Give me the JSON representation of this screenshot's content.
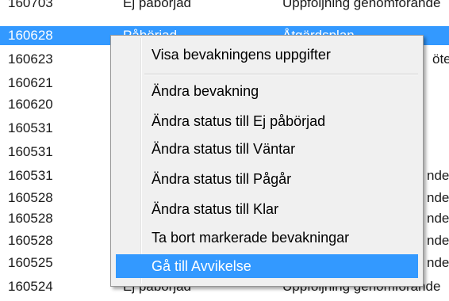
{
  "list": {
    "rows": [
      {
        "date": "160703",
        "status": "Ej påbörjad",
        "desc": "Uppföljning genomförande"
      },
      {
        "date": "160628",
        "status": "Påbörjad",
        "desc": "Åtgärdsplan"
      },
      {
        "date": "160623",
        "status": "",
        "desc": "öte"
      },
      {
        "date": "160621",
        "status": "",
        "desc": ""
      },
      {
        "date": "160620",
        "status": "",
        "desc": ""
      },
      {
        "date": "160531",
        "status": "",
        "desc": ""
      },
      {
        "date": "160531",
        "status": "",
        "desc": ""
      },
      {
        "date": "160531",
        "status": "",
        "desc": "nde"
      },
      {
        "date": "160528",
        "status": "",
        "desc": "nde"
      },
      {
        "date": "160528",
        "status": "",
        "desc": "nde"
      },
      {
        "date": "160528",
        "status": "",
        "desc": "nde"
      },
      {
        "date": "160525",
        "status": "",
        "desc": "nde"
      },
      {
        "date": "160524",
        "status": "Ej påbörjad",
        "desc": "Uppföljning genomförande"
      }
    ]
  },
  "context_menu": {
    "items": [
      {
        "label": "Visa bevakningens uppgifter"
      },
      {
        "label": "Ändra bevakning"
      },
      {
        "label": "Ändra status till Ej påbörjad"
      },
      {
        "label": "Ändra status till Väntar"
      },
      {
        "label": "Ändra status till Pågår"
      },
      {
        "label": "Ändra status till Klar"
      },
      {
        "label": "Ta bort markerade bevakningar"
      },
      {
        "label": "Gå till Avvikelse"
      }
    ]
  },
  "colors": {
    "selection": "#3399ff",
    "menu_background": "#f0f0f0"
  }
}
